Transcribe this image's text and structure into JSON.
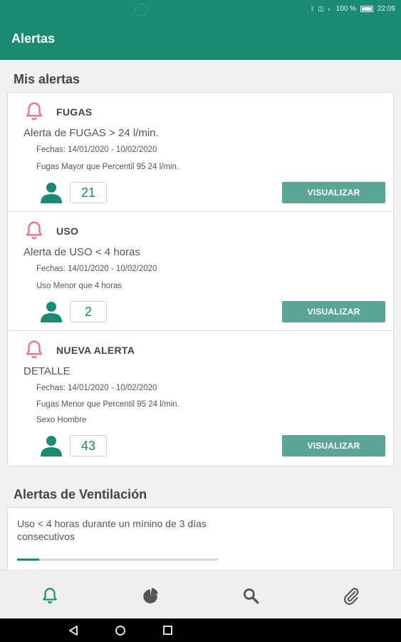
{
  "status": {
    "signal": "ᛒ ◫ ⧖",
    "battery": "100 %",
    "time": "22:09"
  },
  "appbar": {
    "title": "Alertas"
  },
  "mis_alertas": {
    "title": "Mis alertas",
    "alerts": [
      {
        "name": "FUGAS",
        "description": "Alerta de FUGAS > 24 l/min.",
        "lines": [
          "Fechas: 14/01/2020 - 10/02/2020",
          "Fugas Mayor que Percentil 95 24 l/min."
        ],
        "count": "21",
        "button": "VISUALIZAR"
      },
      {
        "name": "USO",
        "description": "Alerta de USO < 4 horas",
        "lines": [
          "Fechas: 14/01/2020 - 10/02/2020",
          "Uso Menor que 4 horas"
        ],
        "count": "2",
        "button": "VISUALIZAR"
      },
      {
        "name": "NUEVA ALERTA",
        "description": "DETALLE",
        "lines": [
          "Fechas: 14/01/2020 - 10/02/2020",
          "Fugas Menor que Percentil 95 24 l/min.",
          "Sexo Hombre"
        ],
        "count": "43",
        "button": "VISUALIZAR"
      }
    ]
  },
  "ventilacion": {
    "title": "Alertas de Ventilación",
    "item": {
      "text": "Uso < 4 horas durante un mínino de 3 días consecutivos",
      "progress": 0.11
    }
  },
  "bottom_nav": {
    "items": [
      "bell-icon",
      "pie-chart-icon",
      "search-icon",
      "paperclip-icon"
    ],
    "active": "bell-icon"
  },
  "colors": {
    "primary": "#1a8a72",
    "button": "#5aa595",
    "bell": "#e07c95"
  }
}
